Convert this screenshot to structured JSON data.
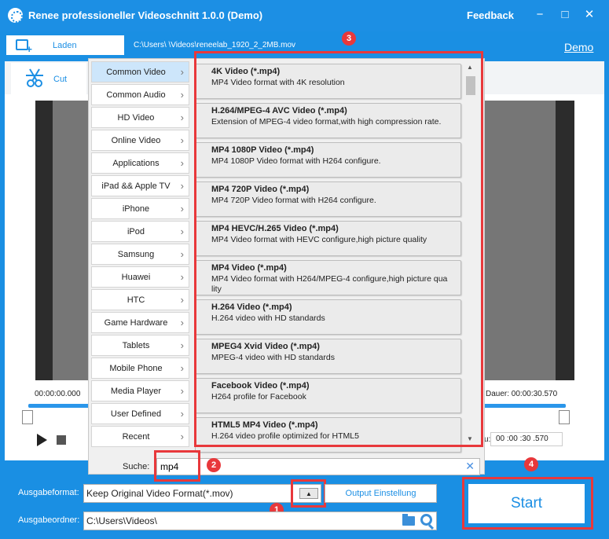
{
  "window": {
    "title": "Renee professioneller Videoschnitt 1.0.0 (Demo)",
    "feedback": "Feedback",
    "minimize_symbol": "−",
    "maximize_symbol": "□",
    "close_symbol": "✕"
  },
  "toolbar": {
    "load_label": "Laden",
    "file_path": "C:\\Users\\    \\Videos\\reneelab_1920_2_2MB.mov",
    "demo_link": "Demo"
  },
  "tabs": {
    "cut_label": "Cut"
  },
  "player": {
    "time_start": "00:00:00.000",
    "duration": "Dauer: 00:00:30.570",
    "end_time_prefix": "u:",
    "end_time": "00 :00 :30 .570"
  },
  "categories": [
    "Common Video",
    "Common Audio",
    "HD Video",
    "Online Video",
    "Applications",
    "iPad && Apple TV",
    "iPhone",
    "iPod",
    "Samsung",
    "Huawei",
    "HTC",
    "Game Hardware",
    "Tablets",
    "Mobile Phone",
    "Media Player",
    "User Defined",
    "Recent"
  ],
  "active_category": "Common Video",
  "formats": [
    {
      "title": "4K Video (*.mp4)",
      "desc": "MP4 Video format with 4K resolution"
    },
    {
      "title": "H.264/MPEG-4 AVC Video (*.mp4)",
      "desc": "Extension of MPEG-4 video format,with high compression rate."
    },
    {
      "title": "MP4 1080P Video (*.mp4)",
      "desc": "MP4 1080P Video format with H264 configure."
    },
    {
      "title": "MP4 720P Video (*.mp4)",
      "desc": "MP4 720P Video format with H264 configure."
    },
    {
      "title": "MP4 HEVC/H.265 Video (*.mp4)",
      "desc": "MP4 Video format with HEVC configure,high picture quality"
    },
    {
      "title": "MP4 Video (*.mp4)",
      "desc": "MP4 Video format with H264/MPEG-4 configure,high picture qua lity"
    },
    {
      "title": "H.264 Video (*.mp4)",
      "desc": "H.264 video with HD standards"
    },
    {
      "title": "MPEG4 Xvid Video (*.mp4)",
      "desc": "MPEG-4 video with HD standards"
    },
    {
      "title": "Facebook Video (*.mp4)",
      "desc": "H264 profile for Facebook"
    },
    {
      "title": "HTML5 MP4 Video (*.mp4)",
      "desc": "H.264 video profile optimized for HTML5"
    }
  ],
  "search": {
    "label": "Suche:",
    "value": "mp4",
    "clear_symbol": "✕"
  },
  "output": {
    "format_label": "Ausgabeformat:",
    "format_value": "Keep Original Video Format(*.mov)",
    "format_arrow": "▲",
    "settings_label": "Output Einstellung",
    "folder_label": "Ausgabeordner:",
    "folder_value": "C:\\Users\\Videos\\"
  },
  "start_label": "Start",
  "badges": [
    "1",
    "2",
    "3",
    "4"
  ],
  "colors": {
    "brand": "#1c8fe4",
    "highlight_red": "#e8383b",
    "active_category": "#cde6fb"
  }
}
